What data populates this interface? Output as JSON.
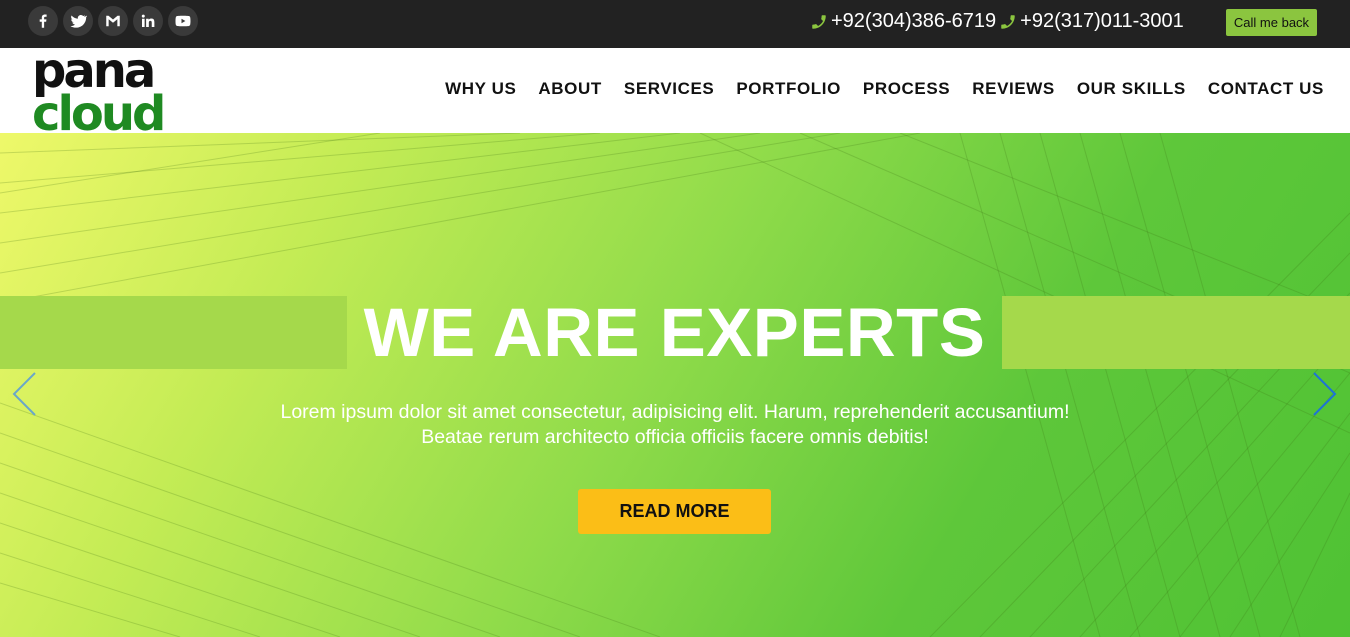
{
  "topbar": {
    "social": [
      {
        "name": "facebook-icon"
      },
      {
        "name": "twitter-icon"
      },
      {
        "name": "gmail-icon"
      },
      {
        "name": "linkedin-icon"
      },
      {
        "name": "youtube-icon"
      }
    ],
    "phones": [
      "+92(304)386-6719",
      "+92(317)011-3001"
    ],
    "call_button": "Call me back"
  },
  "nav": {
    "logo_top": "pana",
    "logo_bottom": "cloud",
    "items": [
      "WHY US",
      "ABOUT",
      "SERVICES",
      "PORTFOLIO",
      "PROCESS",
      "REVIEWS",
      "OUR SKILLS",
      "CONTACT US"
    ]
  },
  "hero": {
    "headline": "WE ARE EXPERTS",
    "subtitle_line1": "Lorem ipsum dolor sit amet consectetur, adipisicing elit. Harum, reprehenderit accusantium!",
    "subtitle_line2": "Beatae rerum architecto officia officiis facere omnis debitis!",
    "button": "READ MORE"
  },
  "colors": {
    "topbar_bg": "#222222",
    "accent_green": "#8bc53f",
    "button_yellow": "#fbbe17",
    "banner_bar": "#a5d94b"
  }
}
